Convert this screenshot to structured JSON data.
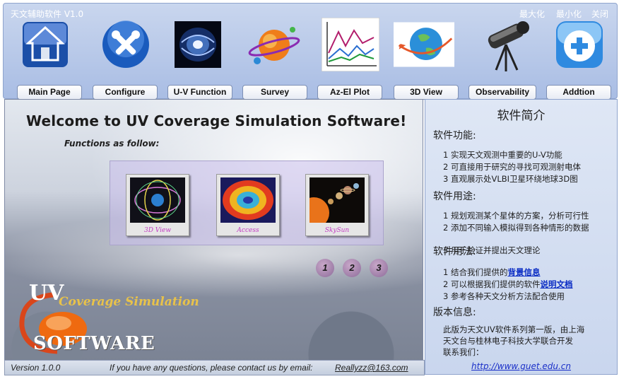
{
  "window": {
    "title": "天文辅助软件  V1.0",
    "maximize": "最大化",
    "minimize": "最小化",
    "close": "关闭"
  },
  "toolbar": {
    "items": [
      {
        "icon": "home-icon",
        "label": "Main Page"
      },
      {
        "icon": "tools-icon",
        "label": "Configure"
      },
      {
        "icon": "galaxy-icon",
        "label": "U-V Function"
      },
      {
        "icon": "planet-icon",
        "label": "Survey"
      },
      {
        "icon": "plot-icon",
        "label": "Az-El Plot"
      },
      {
        "icon": "globe-icon",
        "label": "3D View"
      },
      {
        "icon": "telescope-icon",
        "label": "Observability"
      },
      {
        "icon": "add-icon",
        "label": "Addtion"
      }
    ]
  },
  "main": {
    "welcome": "Welcome to UV Coverage Simulation Software!",
    "functions_label": "Functions as follow:",
    "thumbs": [
      {
        "icon": "orbit-3d-icon",
        "caption": "3D View"
      },
      {
        "icon": "access-sphere-icon",
        "caption": "Access"
      },
      {
        "icon": "solar-system-icon",
        "caption": "SkySun"
      }
    ],
    "pages": [
      "1",
      "2",
      "3"
    ],
    "logo": {
      "uv": "UV",
      "coverage": "Coverage Simulation",
      "software": "SOFTWARE"
    }
  },
  "status": {
    "version": "Version 1.0.0",
    "message": "If you have any questions, please contact us by email:",
    "email": "Reallyzz@163.com"
  },
  "side": {
    "title": "软件简介",
    "s1_head": "软件功能:",
    "s1_items": [
      "1   实现天文观测中重要的U-V功能",
      "2   可直接用于研究的寻找可观测射电体",
      "3   直观展示处VLBI卫星环绕地球3D图"
    ],
    "s2_head": "软件用途:",
    "s2_items": [
      "1   规划观测某个星体的方案，分析可行性",
      "2   添加不同输入模拟得到各种情形的数据",
      "3   用于验证并提出天文理论"
    ],
    "s3_head": "软件用法:",
    "s3_items": [
      {
        "prefix": "1   结合我们提供的",
        "link": "背景信息"
      },
      {
        "prefix": "2   可以根据我们提供的软件",
        "link": "说明文档"
      },
      {
        "prefix": "3   参考各种天文分析方法配合使用",
        "link": ""
      }
    ],
    "s4_head": "版本信息:",
    "s4_text": [
      "此版为天文UV软件系列第一版，由上海",
      "天文台与桂林电子科技大学联合开发",
      "联系我们："
    ],
    "url": "http://www.guet.edu.cn"
  }
}
